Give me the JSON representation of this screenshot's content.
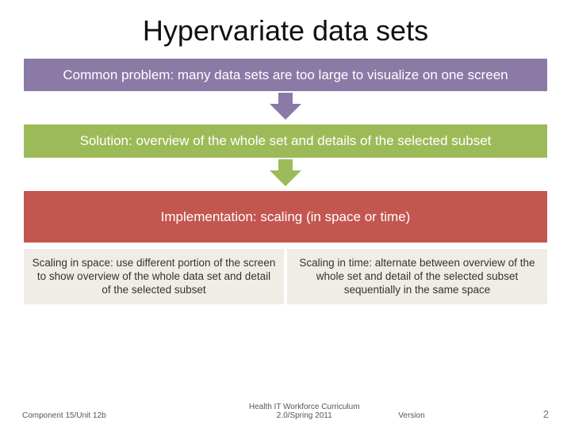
{
  "title": "Hypervariate data sets",
  "blocks": {
    "problem": "Common problem: many data sets are too large to visualize on one screen",
    "solution": "Solution: overview of the whole set and details of the selected subset",
    "implementation": "Implementation: scaling (in space or time)"
  },
  "subs": {
    "space": "Scaling in space: use different portion of the screen to show overview of the whole data set and detail of the selected subset",
    "time": "Scaling in time: alternate between overview of the whole set and detail of the selected subset sequentially in the same space"
  },
  "footer": {
    "left": "Component 15/Unit 12b",
    "mid_line1": "Health IT Workforce Curriculum",
    "mid_line2": "2.0/Spring 2011",
    "right": "Version",
    "page": "2"
  }
}
